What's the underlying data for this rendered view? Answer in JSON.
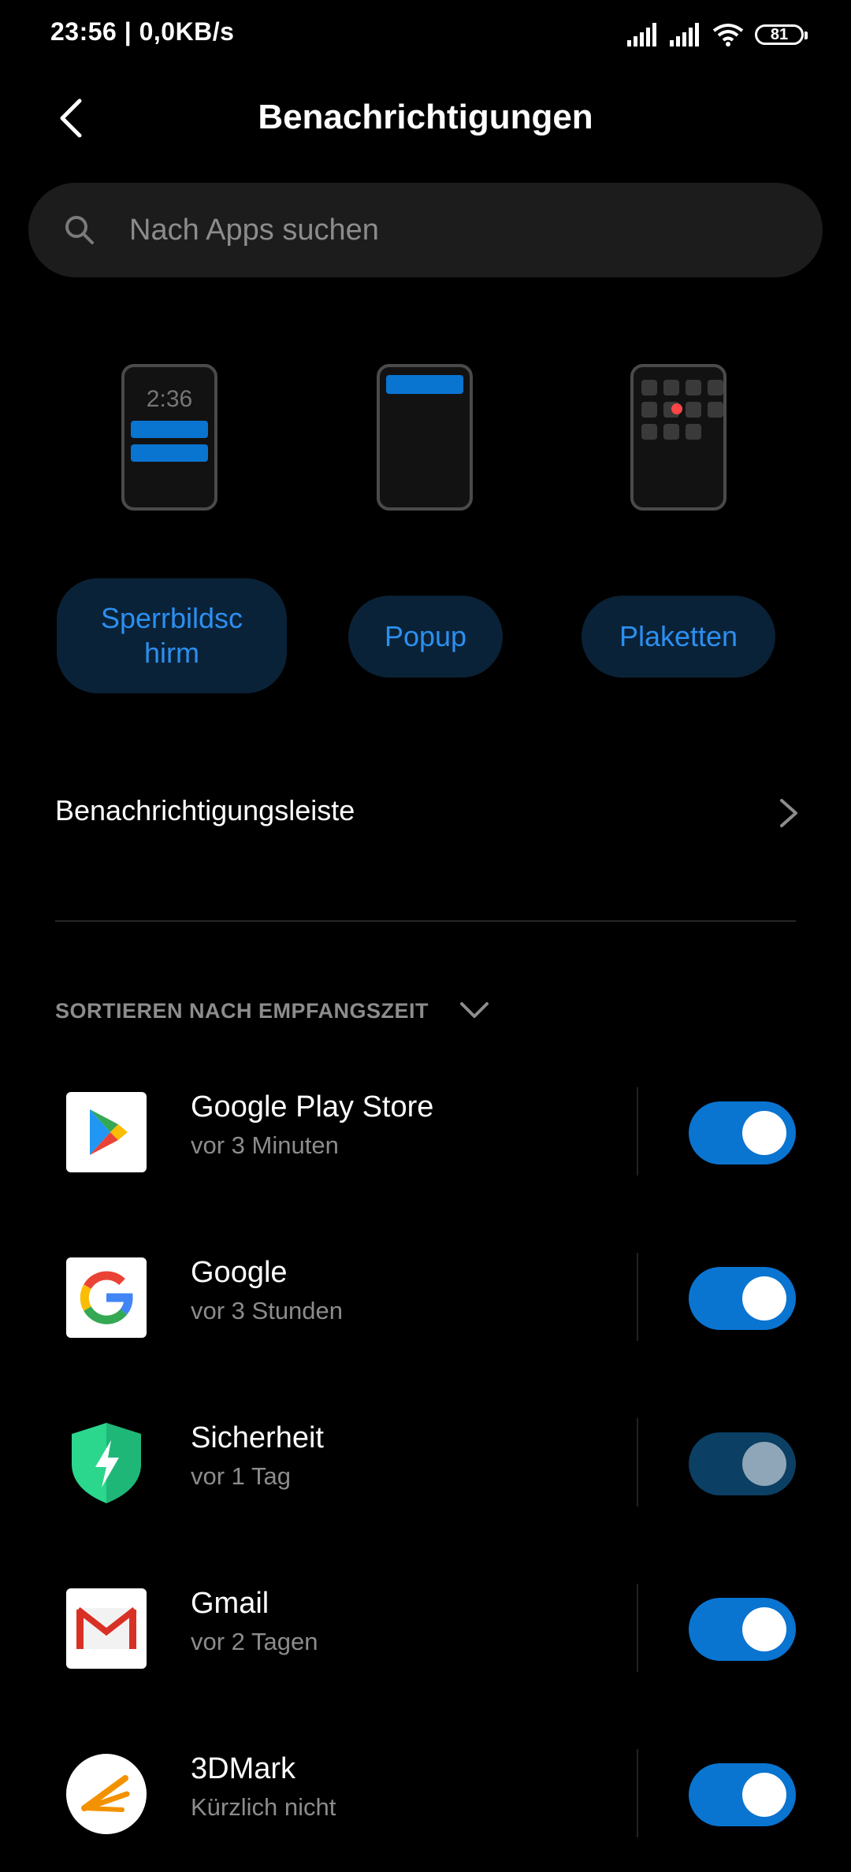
{
  "status_bar": {
    "time": "23:56",
    "speed": "| 0,0KB/s",
    "battery": "81"
  },
  "header": {
    "title": "Benachrichtigungen"
  },
  "search": {
    "placeholder": "Nach Apps suchen"
  },
  "styles": {
    "lockscreen_time": "2:36",
    "items": [
      {
        "label": "Sperrbildsc\nhirm",
        "selected": true
      },
      {
        "label": "Popup",
        "selected": false
      },
      {
        "label": "Plaketten",
        "selected": false
      }
    ]
  },
  "notification_bar": {
    "label": "Benachrichtigungsleiste"
  },
  "sort": {
    "label": "SORTIEREN NACH EMPFANGSZEIT"
  },
  "apps": [
    {
      "name": "Google Play Store",
      "time": "vor 3 Minuten",
      "icon": "play-store-icon",
      "enabled": true
    },
    {
      "name": "Google",
      "time": "vor 3 Stunden",
      "icon": "google-icon",
      "enabled": true
    },
    {
      "name": "Sicherheit",
      "time": "vor 1 Tag",
      "icon": "security-shield-icon",
      "enabled": true,
      "disabled_control": true
    },
    {
      "name": "Gmail",
      "time": "vor 2 Tagen",
      "icon": "gmail-icon",
      "enabled": true
    },
    {
      "name": "3DMark",
      "time": "Kürzlich nicht",
      "icon": "3dmark-icon",
      "enabled": true
    }
  ],
  "colors": {
    "accent": "#0a74d1",
    "pill_bg": "#0a2237",
    "pill_text": "#2c8ff0",
    "secondary_text": "#8c8c8c"
  }
}
